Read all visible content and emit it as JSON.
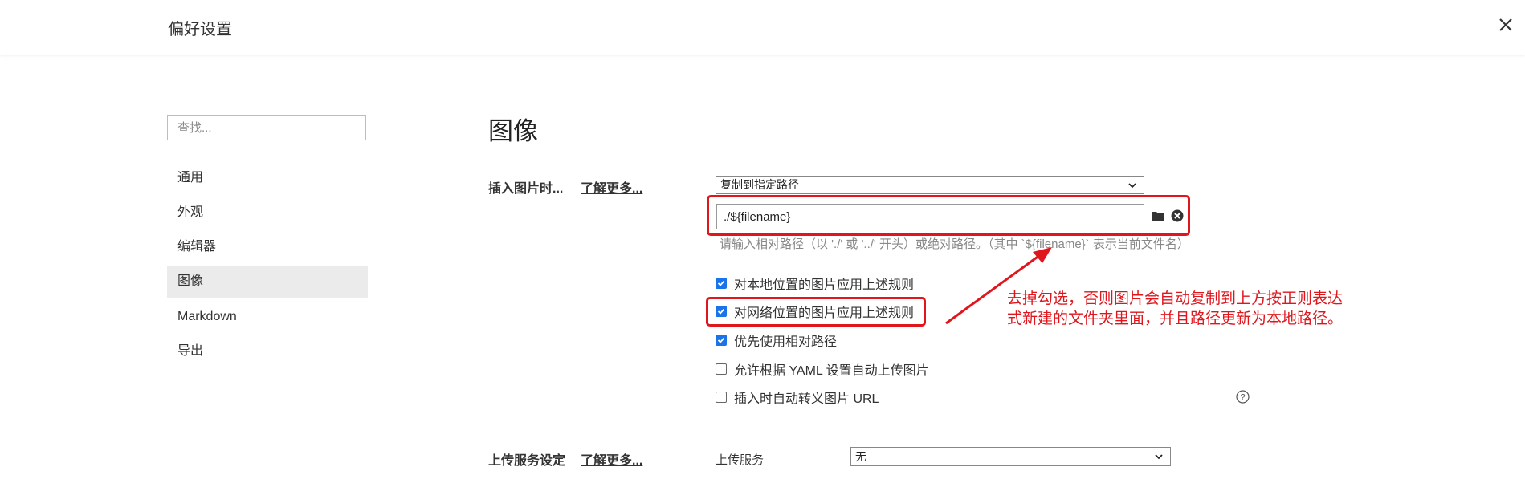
{
  "header": {
    "title": "偏好设置"
  },
  "search": {
    "placeholder": "查找..."
  },
  "sidebar": {
    "items": [
      {
        "label": "通用"
      },
      {
        "label": "外观"
      },
      {
        "label": "编辑器"
      },
      {
        "label": "图像",
        "active": true
      },
      {
        "label": "Markdown"
      },
      {
        "label": "导出"
      }
    ]
  },
  "main": {
    "heading": "图像",
    "insert_image": {
      "label": "插入图片时...",
      "learn_more": "了解更多...",
      "select_value": "复制到指定路径",
      "path_value": "./${filename}",
      "hint": "请输入相对路径（以 './' 或 '../' 开头）或绝对路径。（其中 `${filename}` 表示当前文件名）"
    },
    "checkboxes": [
      {
        "label": "对本地位置的图片应用上述规则",
        "checked": true
      },
      {
        "label": "对网络位置的图片应用上述规则",
        "checked": true
      },
      {
        "label": "优先使用相对路径",
        "checked": true
      },
      {
        "label": "允许根据 YAML 设置自动上传图片",
        "checked": false
      },
      {
        "label": "插入时自动转义图片 URL",
        "checked": false
      }
    ],
    "upload": {
      "label": "上传服务设定",
      "learn_more": "了解更多...",
      "service_label": "上传服务",
      "service_value": "无"
    }
  },
  "annotation": {
    "line1": "去掉勾选，否则图片会自动复制到上方按正则表达",
    "line2": "式新建的文件夹里面，并且路径更新为本地路径。"
  },
  "colors": {
    "accent": "#1a73e8",
    "annotation_red": "#e0161d",
    "active_nav_bg": "#ebebeb"
  },
  "icons": [
    "close-icon",
    "chevron-down-icon",
    "folder-icon",
    "clear-circle-icon",
    "help-circle-icon",
    "checkmark-icon"
  ]
}
